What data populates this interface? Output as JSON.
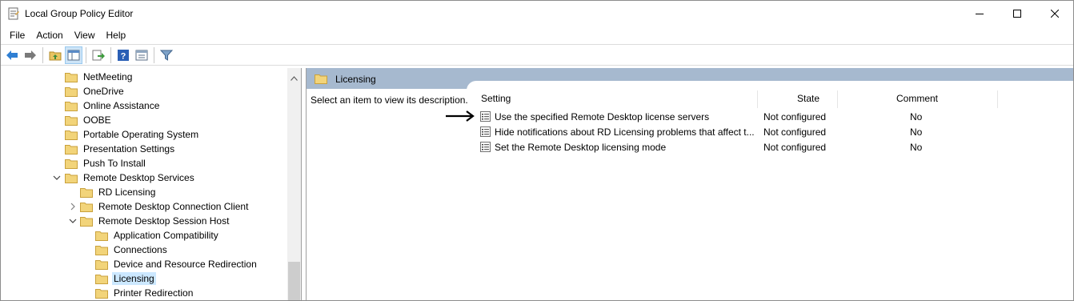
{
  "window": {
    "title": "Local Group Policy Editor",
    "app_icon": "policy-editor-icon",
    "controls": [
      "minimize-icon",
      "maximize-icon",
      "close-icon"
    ]
  },
  "menu": {
    "items": [
      "File",
      "Action",
      "View",
      "Help"
    ]
  },
  "toolbar": {
    "buttons": [
      "back-arrow-icon",
      "forward-arrow-icon",
      "up-folder-icon",
      "show-hide-tree-icon",
      "export-list-icon",
      "help-icon",
      "properties-icon",
      "filter-icon"
    ]
  },
  "tree": {
    "items": [
      {
        "label": "NetMeeting"
      },
      {
        "label": "OneDrive"
      },
      {
        "label": "Online Assistance"
      },
      {
        "label": "OOBE"
      },
      {
        "label": "Portable Operating System"
      },
      {
        "label": "Presentation Settings"
      },
      {
        "label": "Push To Install"
      },
      {
        "label": "Remote Desktop Services",
        "expanded": true
      },
      {
        "label": "RD Licensing"
      },
      {
        "label": "Remote Desktop Connection Client",
        "expanded": false
      },
      {
        "label": "Remote Desktop Session Host",
        "expanded": true
      },
      {
        "label": "Application Compatibility"
      },
      {
        "label": "Connections"
      },
      {
        "label": "Device and Resource Redirection"
      },
      {
        "label": "Licensing",
        "selected": true
      },
      {
        "label": "Printer Redirection"
      }
    ]
  },
  "details": {
    "header_title": "Licensing",
    "description": "Select an item to view its description.",
    "columns": {
      "setting": "Setting",
      "state": "State",
      "comment": "Comment"
    },
    "rows": [
      {
        "setting": "Use the specified Remote Desktop license servers",
        "state": "Not configured",
        "comment": "No"
      },
      {
        "setting": "Hide notifications about RD Licensing problems that affect t...",
        "state": "Not configured",
        "comment": "No"
      },
      {
        "setting": "Set the Remote Desktop licensing mode",
        "state": "Not configured",
        "comment": "No"
      }
    ]
  },
  "annotation": {
    "pointer": "right-arrow-icon"
  },
  "colors": {
    "header_bar": "#a6b9cf",
    "selection": "#cce8ff",
    "folder": "#f2d47a",
    "accent": "#e8612c"
  }
}
